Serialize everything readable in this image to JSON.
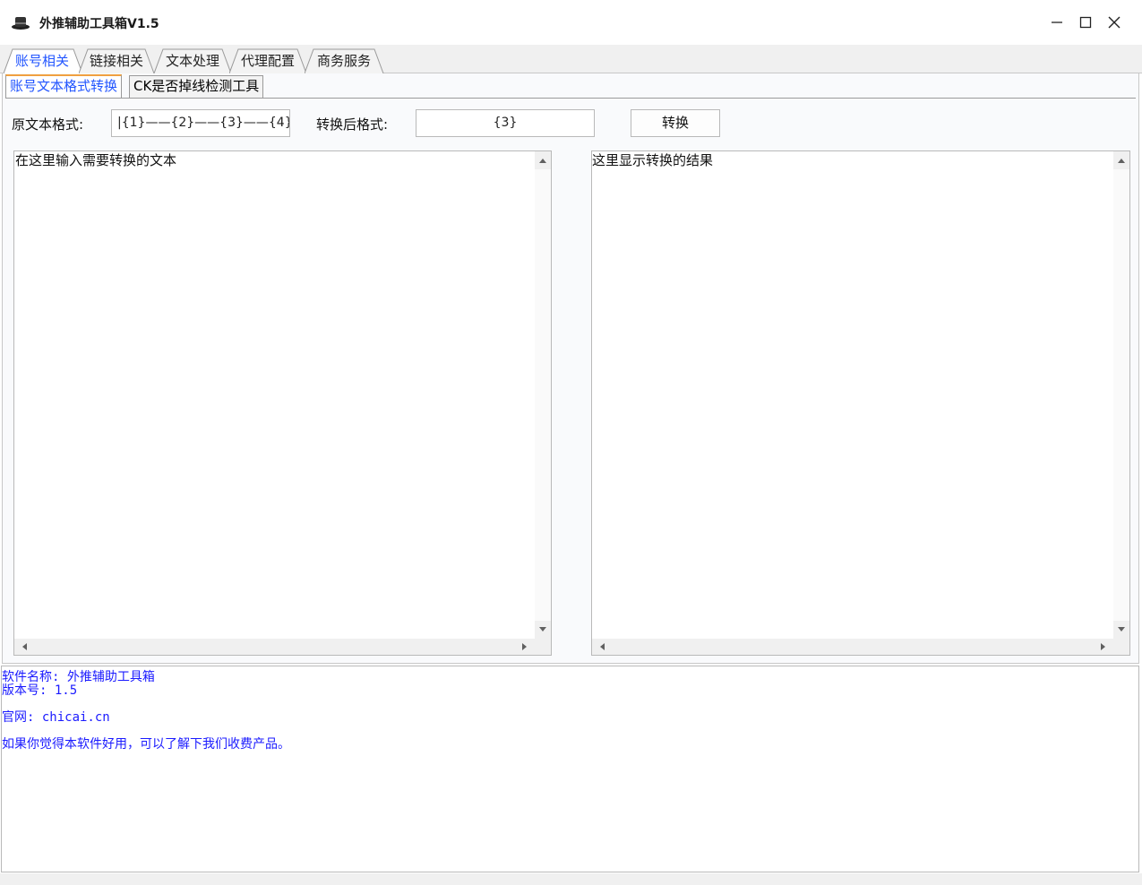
{
  "window": {
    "title": "外推辅助工具箱V1.5",
    "icon": "app-hat-icon",
    "controls": [
      "minimize-icon",
      "maximize-icon",
      "close-icon"
    ]
  },
  "main_tabs": [
    {
      "label": "账号相关",
      "active": true
    },
    {
      "label": "链接相关",
      "active": false
    },
    {
      "label": "文本处理",
      "active": false
    },
    {
      "label": "代理配置",
      "active": false
    },
    {
      "label": "商务服务",
      "active": false
    }
  ],
  "sub_tabs": [
    {
      "label": "账号文本格式转换",
      "active": true
    },
    {
      "label": "CK是否掉线检测工具",
      "active": false
    }
  ],
  "form": {
    "source_label": "原文本格式:",
    "source_value": "|{1}——{2}——{3}——{4}",
    "target_label": "转换后格式:",
    "target_value": "{3}",
    "convert_button": "转换"
  },
  "input_area": {
    "text": "在这里输入需要转换的文本"
  },
  "output_area": {
    "text": "这里显示转换的结果"
  },
  "info": {
    "software_name": "软件名称: 外推辅助工具箱",
    "version": "版本号: 1.5",
    "website": "官网: chicai.cn",
    "promo": "如果你觉得本软件好用，可以了解下我们收费产品。"
  },
  "colors": {
    "accent_blue": "#2255ff",
    "info_text": "#1a1aff",
    "active_tab_top": "#f0a040"
  }
}
